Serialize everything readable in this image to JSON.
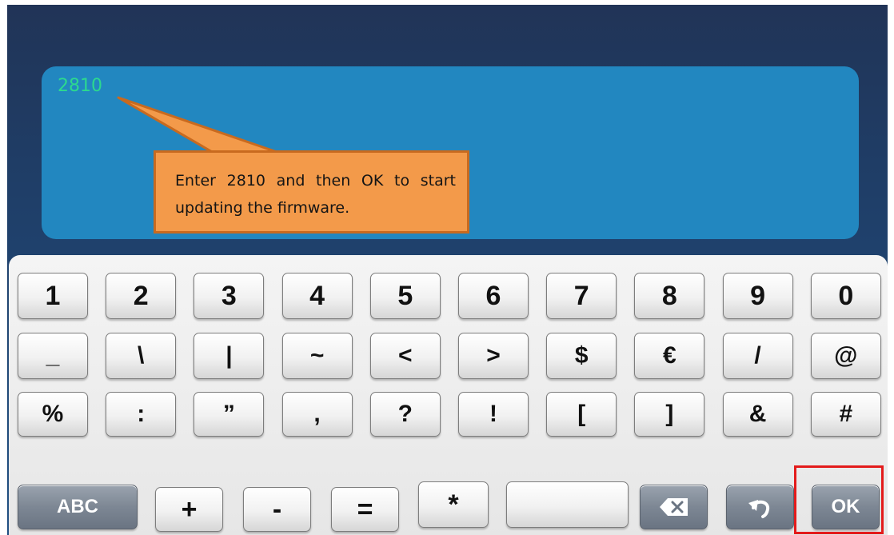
{
  "display": {
    "typed_text": "2810",
    "callout_text": "Enter 2810 and then OK to start updating the firmware."
  },
  "keyboard": {
    "row1": [
      "1",
      "2",
      "3",
      "4",
      "5",
      "6",
      "7",
      "8",
      "9",
      "0"
    ],
    "row2": [
      "_",
      "\\",
      "|",
      "~",
      "<",
      ">",
      "$",
      "€",
      "/",
      "@"
    ],
    "row3": [
      "%",
      ":",
      "”",
      ",",
      "?",
      "!",
      "[",
      "]",
      "&",
      "#"
    ],
    "row4": {
      "abc_label": "ABC",
      "plus": "+",
      "minus": "-",
      "equals": "=",
      "asterisk": "*",
      "space": "",
      "backspace_icon": "backspace-icon",
      "undo_icon": "undo-icon",
      "ok_label": "OK"
    }
  },
  "colors": {
    "typed_text": "#2cd98f",
    "callout_fill": "#f39a4a",
    "highlight_border": "#e31b1b"
  }
}
